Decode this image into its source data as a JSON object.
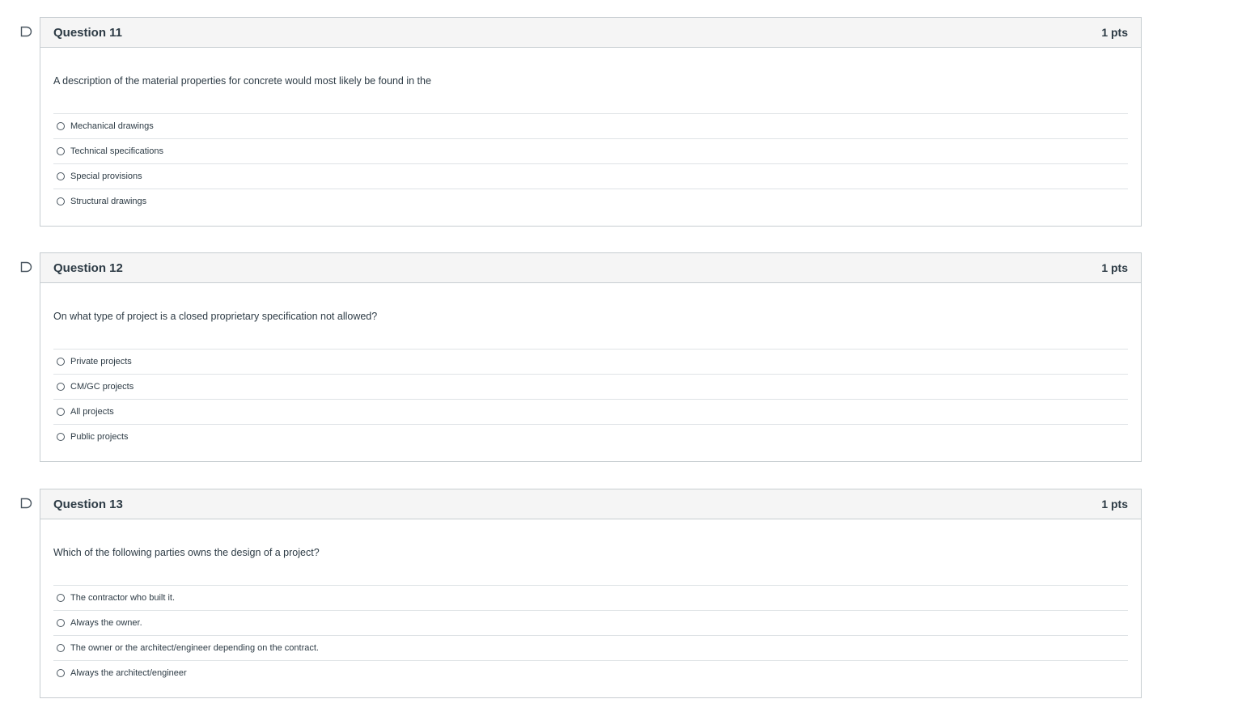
{
  "questions": [
    {
      "title": "Question 11",
      "points": "1 pts",
      "text": "A description of the material properties for concrete would most likely be found in the",
      "answers": [
        "Mechanical drawings",
        "Technical specifications",
        "Special provisions",
        "Structural drawings"
      ]
    },
    {
      "title": "Question 12",
      "points": "1 pts",
      "text": "On what type of project is a closed proprietary specification not allowed?",
      "answers": [
        "Private projects",
        "CM/GC projects",
        "All projects",
        "Public projects"
      ]
    },
    {
      "title": "Question 13",
      "points": "1 pts",
      "text": "Which of the following parties owns the design of a project?",
      "answers": [
        "The contractor who built it.",
        "Always the owner.",
        "The owner or the architect/engineer depending on the contract.",
        "Always the architect/engineer"
      ]
    }
  ],
  "icons": {
    "flag": "flag-icon",
    "radio": "radio-button-icon"
  },
  "colors": {
    "border": "#c7cdd1",
    "header_bg": "#f5f5f5",
    "text": "#2d3b45"
  }
}
